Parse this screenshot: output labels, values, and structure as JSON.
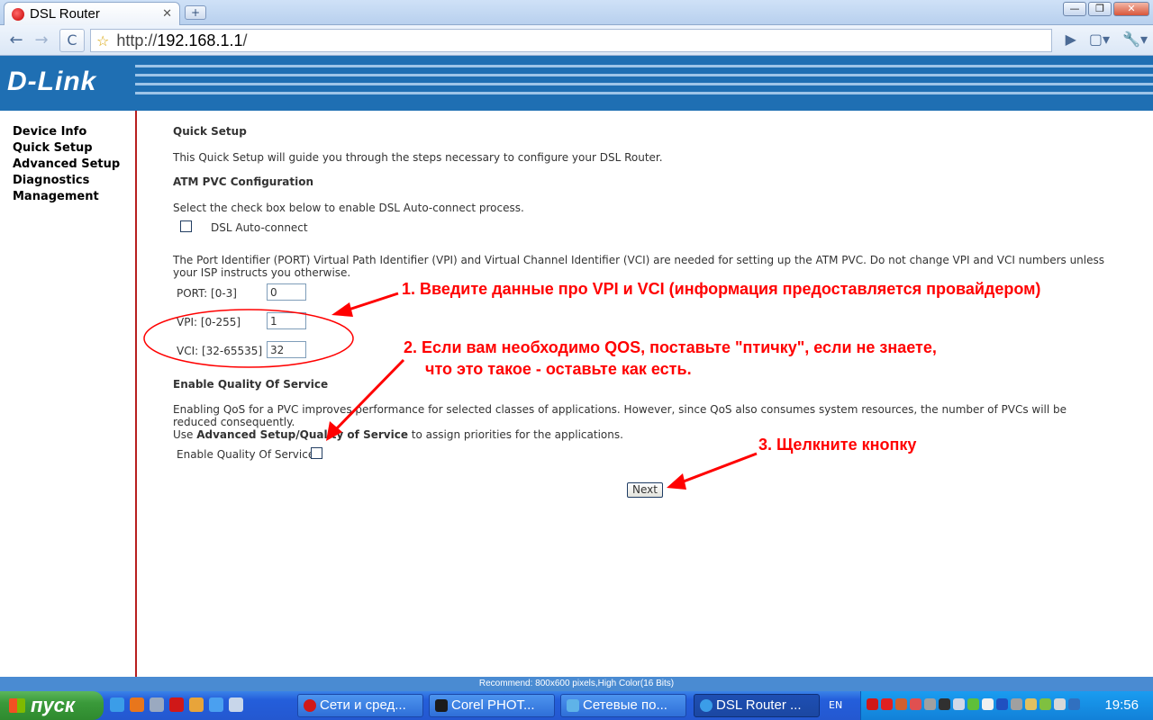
{
  "browser": {
    "tab_title": "DSL Router",
    "tab_close": "✕",
    "new_tab": "+",
    "window_buttons": {
      "minimize": "—",
      "maximize": "❐",
      "close": "✕"
    },
    "back": "←",
    "forward": "→",
    "reload": "C",
    "bookmark": "☆",
    "url_scheme": "http://",
    "url_host": "192.168.1.1",
    "url_rest": "/",
    "go": "▶",
    "page_menu": "▢▾",
    "tools_menu": "🔧▾"
  },
  "header": {
    "logo": "D-Link"
  },
  "sidebar": {
    "items": [
      {
        "label": "Device Info"
      },
      {
        "label": "Quick Setup"
      },
      {
        "label": "Advanced Setup"
      },
      {
        "label": "Diagnostics"
      },
      {
        "label": "Management"
      }
    ]
  },
  "main": {
    "title": "Quick Setup",
    "intro": "This Quick Setup will guide you through the steps necessary to configure your DSL Router.",
    "atm_heading": "ATM PVC Configuration",
    "autoconnect_hint": "Select the check box below to enable DSL Auto-connect process.",
    "autoconnect_label": "DSL Auto-connect",
    "pvc_text": "The Port Identifier (PORT) Virtual Path Identifier (VPI) and Virtual Channel Identifier (VCI) are needed for setting up the ATM PVC. Do not change VPI and VCI numbers unless your ISP instructs you otherwise.",
    "port_label": "PORT: [0-3]",
    "port_value": "0",
    "vpi_label": "VPI: [0-255]",
    "vpi_value": "1",
    "vci_label": "VCI: [32-65535]",
    "vci_value": "32",
    "qos_heading": "Enable Quality Of Service",
    "qos_text_1": "Enabling QoS for a PVC improves performance for selected classes of applications. However, since QoS also consumes system resources, the number of PVCs will be reduced consequently.",
    "qos_text_2_pre": "Use ",
    "qos_text_2_bold": "Advanced Setup/Quality of Service",
    "qos_text_2_post": " to assign priorities for the applications.",
    "qos_label": "Enable Quality Of Service",
    "next_button": "Next"
  },
  "annotations": {
    "note1": "1. Введите данные про VPI и VCI (информация предоставляется провайдером)",
    "note2_line1": "2. Если вам необходимо QOS, поставьте \"птичку\", если не знаете,",
    "note2_line2": "что это такое - оставьте как есть.",
    "note3": "3. Щелкните кнопку",
    "color": "#ff0000"
  },
  "status_bar": {
    "text": "Recommend: 800x600 pixels,High Color(16 Bits)"
  },
  "taskbar": {
    "start_label": "пуск",
    "tasks": [
      {
        "label": "Сети и сред..."
      },
      {
        "label": "Corel PHOT..."
      },
      {
        "label": "Сетевые по..."
      },
      {
        "label": "DSL Router ..."
      }
    ],
    "language": "EN",
    "clock": "19:56"
  }
}
